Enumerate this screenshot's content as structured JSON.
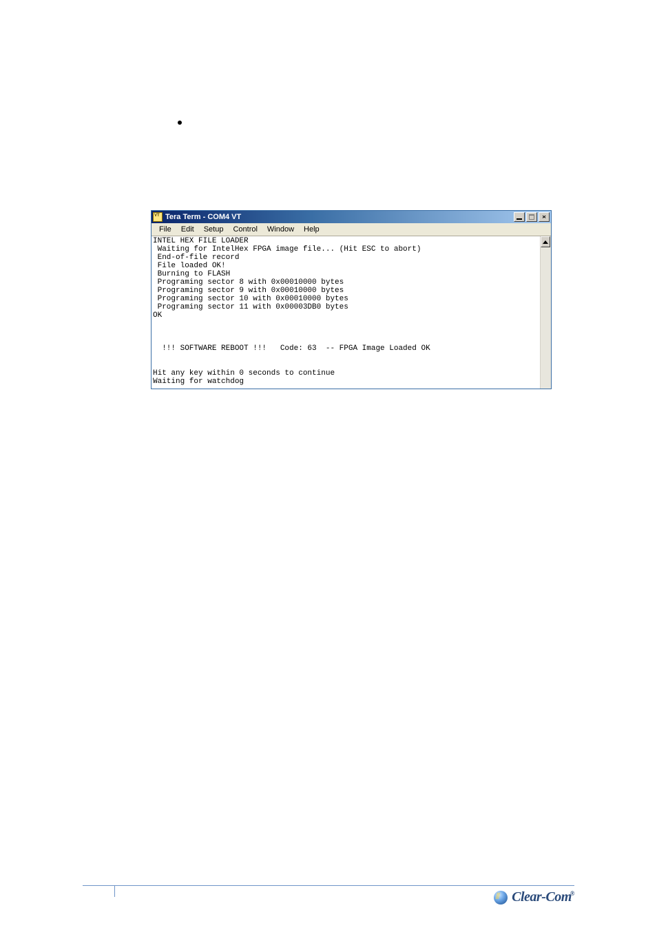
{
  "window": {
    "title": "Tera Term - COM4 VT"
  },
  "menubar": [
    "File",
    "Edit",
    "Setup",
    "Control",
    "Window",
    "Help"
  ],
  "terminal_lines": [
    "INTEL HEX FILE LOADER",
    " Waiting for IntelHex FPGA image file... (Hit ESC to abort)",
    " End-of-file record",
    " File loaded OK!",
    " Burning to FLASH",
    " Programing sector 8 with 0x00010000 bytes",
    " Programing sector 9 with 0x00010000 bytes",
    " Programing sector 10 with 0x00010000 bytes",
    " Programing sector 11 with 0x00003DB0 bytes",
    "OK",
    "",
    "",
    "",
    "  !!! SOFTWARE REBOOT !!!   Code: 63  -- FPGA Image Loaded OK",
    "",
    "",
    "Hit any key within 0 seconds to continue",
    "Waiting for watchdog"
  ],
  "brand": "Clear-Com"
}
